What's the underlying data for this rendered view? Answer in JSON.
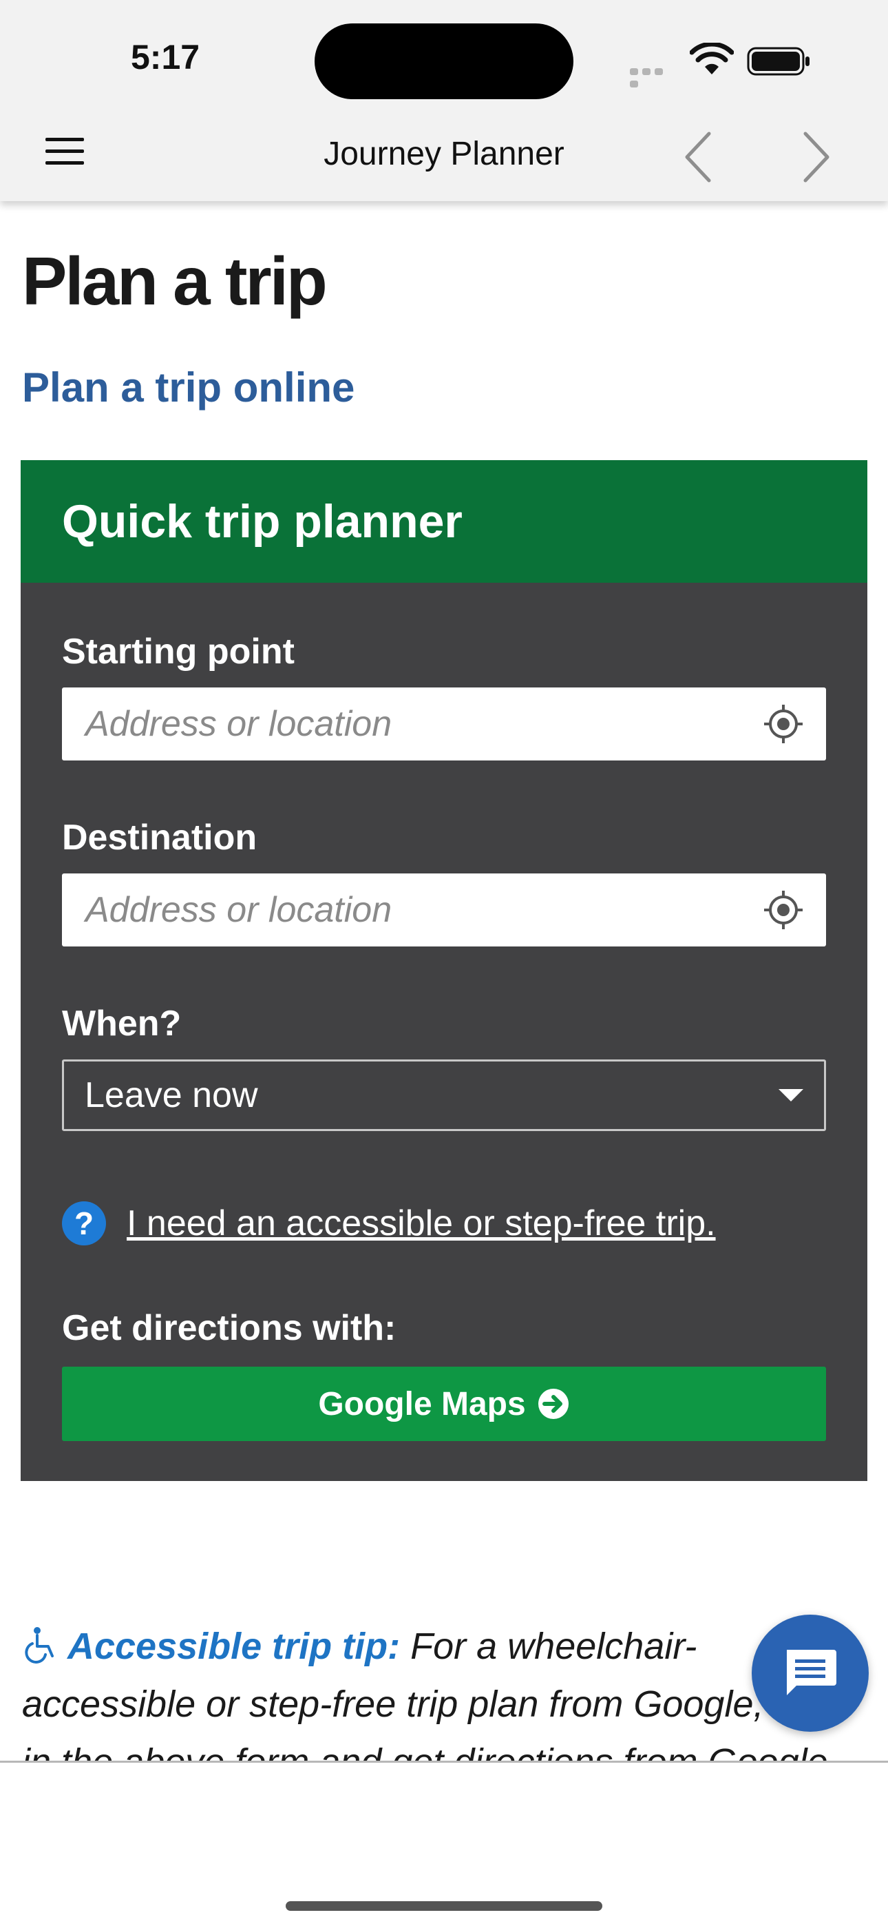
{
  "status_bar": {
    "time": "5:17"
  },
  "nav": {
    "title": "Journey Planner"
  },
  "page": {
    "title": "Plan a trip",
    "subtitle_link": "Plan a trip online"
  },
  "planner": {
    "heading": "Quick trip planner",
    "starting_point": {
      "label": "Starting point",
      "placeholder": "Address or location"
    },
    "destination": {
      "label": "Destination",
      "placeholder": "Address or location"
    },
    "when": {
      "label": "When?",
      "selected": "Leave now"
    },
    "accessible_link": "I need an accessible or step-free trip.",
    "directions_label": "Get directions with:",
    "google_button": "Google Maps"
  },
  "tip": {
    "title": "Accessible trip tip:",
    "body": " For a wheelchair-accessible or step-free trip plan from Google, fill in the above form and get directions from Google"
  },
  "colors": {
    "brand_green": "#0a7238",
    "button_green": "#0e9744",
    "panel_gray": "#414143",
    "link_blue": "#2d5d9a",
    "tip_blue": "#1e74c4",
    "fab_blue": "#2a63b3"
  },
  "icons": {
    "menu": "hamburger-menu-icon",
    "back": "chevron-left-icon",
    "forward": "chevron-right-icon",
    "location": "crosshair-location-icon",
    "help": "question-circle-icon",
    "arrow": "arrow-right-circle-icon",
    "wheelchair": "wheelchair-icon",
    "chat": "chat-bubble-icon"
  }
}
